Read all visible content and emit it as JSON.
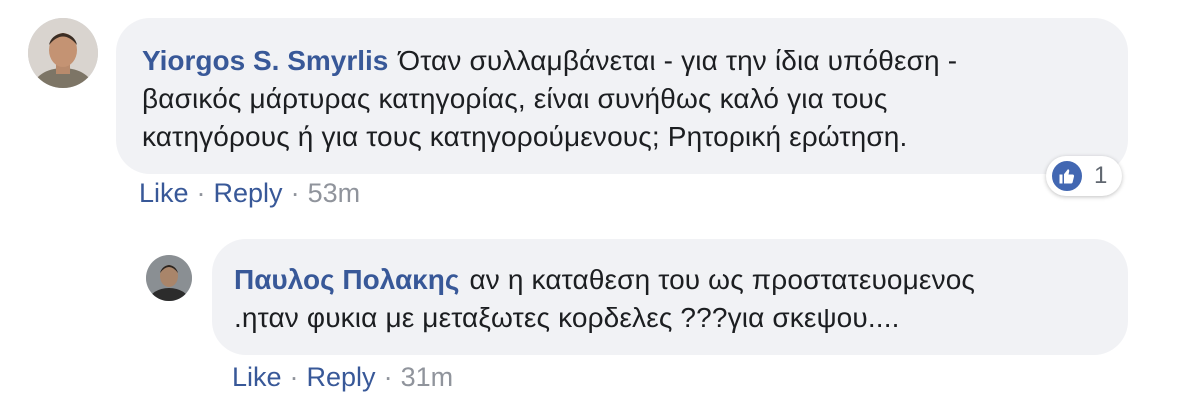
{
  "comments": [
    {
      "author": "Yiorgos S. Smyrlis",
      "line1": "Όταν συλλαμβάνεται - για την ίδια υπόθεση -",
      "line2": "βασικός μάρτυρας κατηγορίας, είναι συνήθως καλό για τους",
      "line3": "κατηγόρους ή για τους κατηγορούμενους; Ρητορική ερώτηση.",
      "like_label": "Like",
      "reply_label": "Reply",
      "separator": "·",
      "time": "53m",
      "reaction_count": "1",
      "reaction_icon": "thumbs-up-icon",
      "avatar_icon": "avatar-photo"
    },
    {
      "author": "Παυλος Πολακης",
      "line1": "αν η καταθεση του ως προστατευομενος",
      "line2": ".ηταν φυκια με μεταξωτες κορδελες ???για σκεψου....",
      "like_label": "Like",
      "reply_label": "Reply",
      "separator": "·",
      "time": "31m",
      "avatar_icon": "avatar-photo"
    }
  ],
  "colors": {
    "bubble_bg": "#f1f2f5",
    "author": "#385898",
    "link": "#385898",
    "meta": "#90949c",
    "like_blue": "#4267b2"
  }
}
